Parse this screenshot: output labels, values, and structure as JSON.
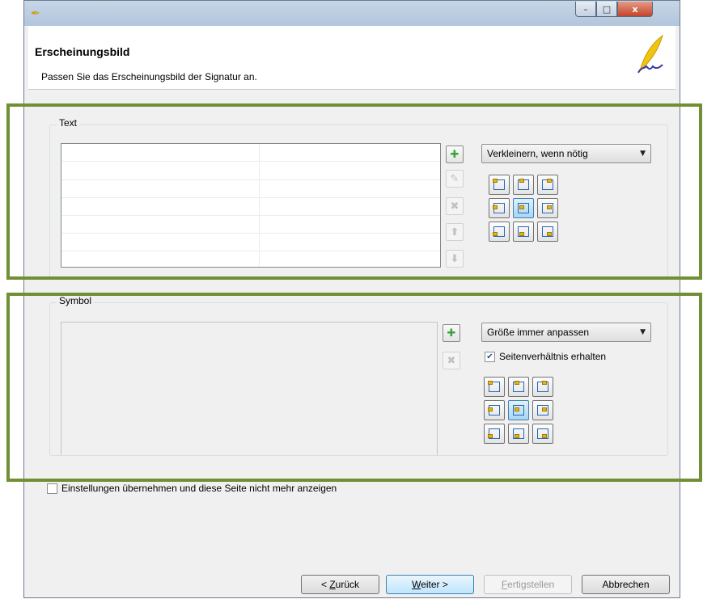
{
  "window": {
    "controls": {
      "minimize": "–",
      "maximize": "□",
      "close": "x"
    }
  },
  "header": {
    "title": "Erscheinungsbild",
    "subtitle": "Passen Sie das Erscheinungsbild der Signatur an."
  },
  "text_group": {
    "label": "Text",
    "combo_value": "Verkleinern, wenn nötig",
    "buttons": {
      "add": "✚",
      "edit": "✎",
      "delete": "✖",
      "up": "⬆",
      "down": "⬇"
    }
  },
  "symbol_group": {
    "label": "Symbol",
    "combo_value": "Größe immer anpassen",
    "keep_ratio_label": "Seitenverhältnis erhalten",
    "keep_ratio_checked": true,
    "buttons": {
      "add": "✚",
      "delete": "✖"
    }
  },
  "dont_show": {
    "label": "Einstellungen übernehmen und diese Seite nicht mehr anzeigen",
    "checked": false
  },
  "footer": {
    "back": {
      "prefix": "< ",
      "mnemonic": "Z",
      "rest": "urück"
    },
    "next": {
      "mnemonic": "W",
      "rest": "eiter >"
    },
    "finish": {
      "mnemonic": "F",
      "rest": "ertigstellen"
    },
    "cancel": "Abbrechen"
  },
  "positions": [
    "top-left",
    "top-center",
    "top-right",
    "middle-left",
    "center",
    "middle-right",
    "bottom-left",
    "bottom-center",
    "bottom-right"
  ],
  "selected_position": "center",
  "colors": {
    "highlight": "#718f35",
    "accent": "#3c7fb1"
  }
}
